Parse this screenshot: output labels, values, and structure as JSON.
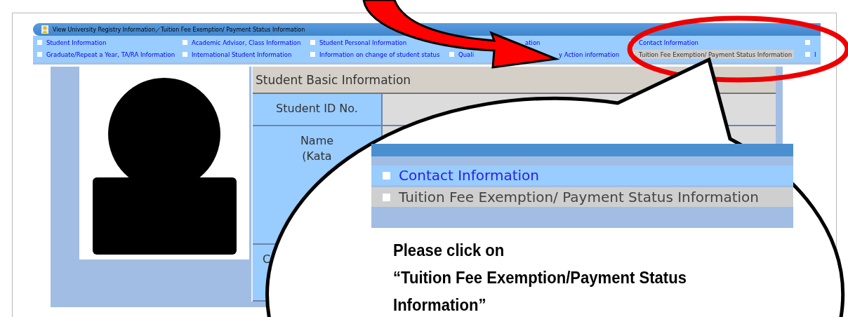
{
  "header": {
    "title": "View University Registry Information／Tuition Fee Exemption/ Payment Status Information"
  },
  "nav_rows": [
    [
      {
        "kind": "link",
        "label": "Student Information",
        "selected": false
      },
      {
        "kind": "link",
        "label": "Academic Advisor, Class Information",
        "selected": false
      },
      {
        "kind": "link",
        "label": "Student Personal Information",
        "selected": false
      },
      {
        "kind": "fragment",
        "label": "ation",
        "selected": false
      },
      {
        "kind": "link",
        "label": "Contact Information",
        "selected": false
      },
      {
        "kind": "box",
        "selected": false
      }
    ],
    [
      {
        "kind": "link",
        "label": "Graduate/Repeat a Year, TA/RA Information",
        "selected": false
      },
      {
        "kind": "link",
        "label": "International Student Information",
        "selected": false
      },
      {
        "kind": "link",
        "label": "Information on change of student status",
        "selected": false
      },
      {
        "kind": "link",
        "label": "Quali",
        "selected": false
      },
      {
        "kind": "fragment",
        "label": "y Action information",
        "selected": false
      },
      {
        "kind": "link",
        "label": "Tuition Fee Exemption/ Payment Status Information",
        "selected": true
      },
      {
        "kind": "link",
        "label": "I",
        "selected": false
      }
    ]
  ],
  "basic_info": {
    "title": "Student Basic Information",
    "fields": [
      {
        "label_lines": [
          "Student ID No."
        ]
      },
      {
        "label_lines": [
          "Name",
          "(Kata"
        ]
      },
      {
        "label_lines": [
          "C"
        ]
      }
    ]
  },
  "callout": {
    "menu_items": [
      {
        "label": "Contact Information",
        "selected": false
      },
      {
        "label": "Tuition Fee Exemption/ Payment Status Information",
        "selected": true
      }
    ],
    "instruction_lines": [
      "Please click on",
      "“Tuition Fee Exemption/Payment Status",
      "Information”"
    ]
  }
}
